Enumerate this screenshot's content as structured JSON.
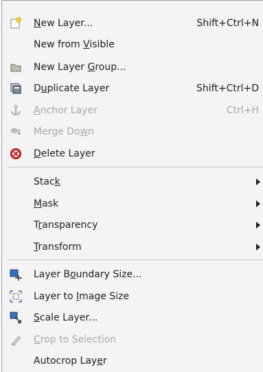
{
  "menu": {
    "items": [
      {
        "label_pre": "",
        "mnemonic": "N",
        "label_post": "ew Layer...",
        "shortcut": "Shift+Ctrl+N",
        "icon": "new-layer-icon"
      },
      {
        "label_pre": "New from ",
        "mnemonic": "V",
        "label_post": "isible",
        "shortcut": "",
        "icon": ""
      },
      {
        "label_pre": "New Layer ",
        "mnemonic": "G",
        "label_post": "roup...",
        "shortcut": "",
        "icon": "layer-group-icon"
      },
      {
        "label_pre": "D",
        "mnemonic": "u",
        "label_post": "plicate Layer",
        "shortcut": "Shift+Ctrl+D",
        "icon": "duplicate-icon"
      },
      {
        "label_pre": "",
        "mnemonic": "A",
        "label_post": "nchor Layer",
        "shortcut": "Ctrl+H",
        "icon": "anchor-icon",
        "disabled": true
      },
      {
        "label_pre": "Merge Do",
        "mnemonic": "w",
        "label_post": "n",
        "shortcut": "",
        "icon": "merge-down-icon",
        "disabled": true
      },
      {
        "label_pre": "",
        "mnemonic": "D",
        "label_post": "elete Layer",
        "shortcut": "",
        "icon": "delete-icon"
      },
      {
        "label_pre": "Stac",
        "mnemonic": "k",
        "label_post": "",
        "submenu": true
      },
      {
        "label_pre": "",
        "mnemonic": "M",
        "label_post": "ask",
        "submenu": true
      },
      {
        "label_pre": "T",
        "mnemonic": "r",
        "label_post": "ansparency",
        "submenu": true
      },
      {
        "label_pre": "",
        "mnemonic": "T",
        "label_post": "ransform",
        "submenu": true
      },
      {
        "label_pre": "Layer B",
        "mnemonic": "o",
        "label_post": "undary Size...",
        "icon": "layer-boundary-icon"
      },
      {
        "label_pre": "Layer to ",
        "mnemonic": "I",
        "label_post": "mage Size",
        "icon": "layer-to-image-icon"
      },
      {
        "label_pre": "",
        "mnemonic": "S",
        "label_post": "cale Layer...",
        "icon": "scale-layer-icon"
      },
      {
        "label_pre": "",
        "mnemonic": "C",
        "label_post": "rop to Selection",
        "icon": "crop-icon",
        "disabled": true
      },
      {
        "label_pre": "Autocrop Lay",
        "mnemonic": "e",
        "label_post": "r",
        "icon": ""
      }
    ]
  }
}
